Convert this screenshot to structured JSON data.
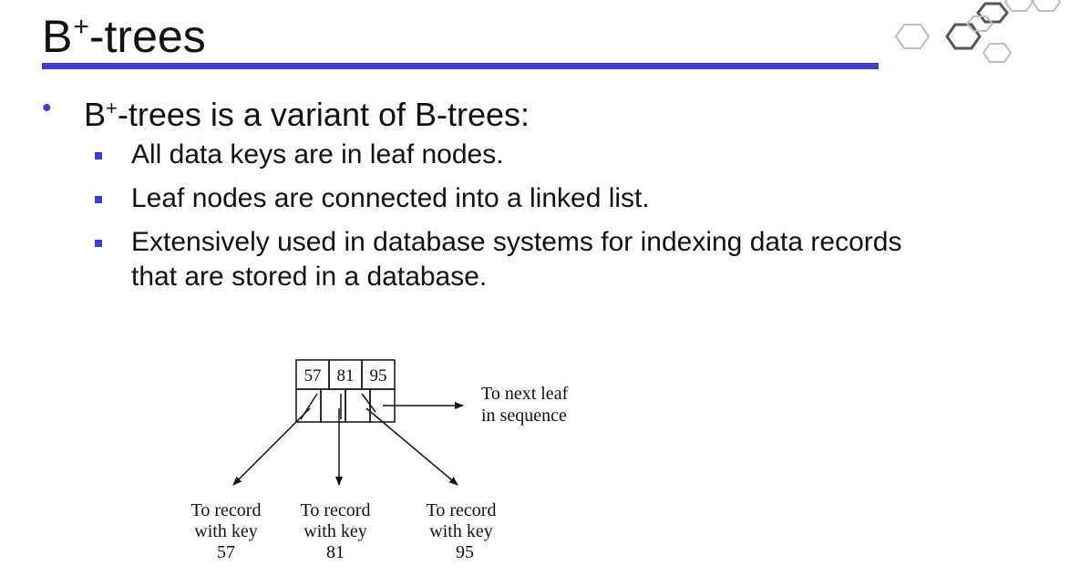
{
  "slide": {
    "title_base": "B",
    "title_sup": "+",
    "title_rest": "-trees",
    "bullet": {
      "marker": "•",
      "base": "B",
      "sup": "+",
      "rest": "-trees is a variant of B-trees:"
    },
    "sub_bullets": [
      {
        "text": "All data keys are in leaf nodes."
      },
      {
        "text": "Leaf nodes are connected into a linked list."
      },
      {
        "line1": "Extensively used in database systems for indexing data records",
        "line2": "that are stored in a database."
      }
    ]
  },
  "diagram": {
    "keys": [
      "57",
      "81",
      "95"
    ],
    "next_label": [
      "To next leaf",
      "in sequence"
    ],
    "records": [
      {
        "l1": "To record",
        "l2": "with key",
        "l3": "57"
      },
      {
        "l1": "To record",
        "l2": "with key",
        "l3": "81"
      },
      {
        "l1": "To record",
        "l2": "with key",
        "l3": "95"
      }
    ]
  },
  "colors": {
    "accent": "#3d3fc6",
    "text": "#111111",
    "hex_outline": "#bdbdbd",
    "hex_dark": "#555555"
  }
}
